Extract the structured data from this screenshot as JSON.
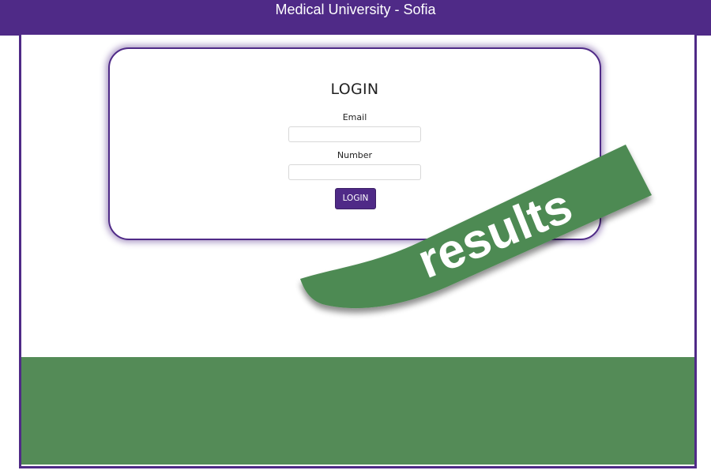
{
  "header": {
    "title": "Medical University - Sofia"
  },
  "login_form": {
    "heading": "LOGIN",
    "email_label": "Email",
    "email_value": "",
    "number_label": "Number",
    "number_value": "",
    "submit_label": "LOGIN"
  },
  "banner": {
    "text": "results"
  },
  "colors": {
    "brand": "#4f2a87",
    "accent_green": "#548b57",
    "ribbon_green": "#4e8a53"
  }
}
